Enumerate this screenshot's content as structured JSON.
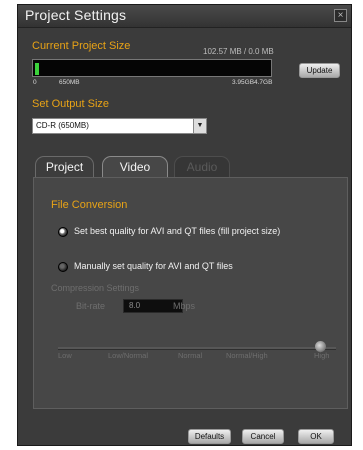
{
  "window": {
    "title": "Project Settings",
    "close_glyph": "×"
  },
  "project_size": {
    "label": "Current Project Size",
    "readout": "102.57 MB / 0.0 MB",
    "fill_percent": 1.5,
    "ticks": [
      "0",
      "650MB",
      "3.95GB",
      "4.7GB"
    ],
    "update_label": "Update"
  },
  "output_size": {
    "label": "Set Output Size",
    "value": "CD-R (650MB)"
  },
  "tabs": [
    {
      "label": "Project",
      "state": "inactive"
    },
    {
      "label": "Video",
      "state": "active"
    },
    {
      "label": "Audio",
      "state": "disabled"
    }
  ],
  "file_conversion": {
    "label": "File Conversion",
    "options": [
      {
        "label": "Set best quality for AVI and QT files (fill project size)",
        "selected": true
      },
      {
        "label": "Manually set quality for AVI and QT files",
        "selected": false
      }
    ]
  },
  "compression": {
    "label": "Compression Settings",
    "bitrate_label": "Bit-rate",
    "bitrate_value": "8.0",
    "bitrate_unit": "Mbps",
    "quality_marks": [
      "Low",
      "Low/Normal",
      "Normal",
      "Normal/High",
      "High"
    ],
    "quality_level": "High"
  },
  "buttons": {
    "defaults": "Defaults",
    "cancel": "Cancel",
    "ok": "OK"
  },
  "colors": {
    "accent": "#e8a316",
    "fill": "#3bd23b"
  }
}
